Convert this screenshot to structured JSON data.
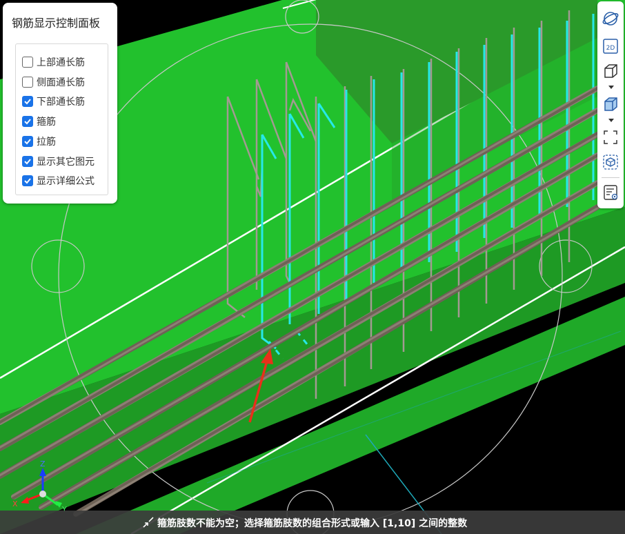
{
  "panel": {
    "title": "钢筋显示控制面板",
    "options": [
      {
        "label": "上部通长筋",
        "checked": false
      },
      {
        "label": "侧面通长筋",
        "checked": false
      },
      {
        "label": "下部通长筋",
        "checked": true
      },
      {
        "label": "箍筋",
        "checked": true
      },
      {
        "label": "拉筋",
        "checked": true
      },
      {
        "label": "显示其它图元",
        "checked": true
      },
      {
        "label": "显示详细公式",
        "checked": true
      }
    ]
  },
  "toolbar": {
    "icons": [
      "orbit-icon",
      "view-2d-icon",
      "view-3d-box-icon",
      "shaded-box-icon",
      "fit-view-icon",
      "section-box-icon",
      "properties-icon"
    ],
    "view_2d_label": "2D"
  },
  "status": {
    "message": "箍筋肢数不能为空；选择箍筋肢数的组合形式或输入 [1,10] 之间的整数"
  },
  "axes": {
    "x": "X",
    "y": "Y",
    "z": "Z"
  },
  "colors": {
    "beam_top": "#22c12d",
    "beam_side": "#1e9a24",
    "column": "#2a9a2a",
    "stirrup_highlight": "#26e8e8",
    "stirrup": "#a39a92",
    "rebar": "#6a5a4a",
    "selected_arrow": "#e8301a"
  }
}
